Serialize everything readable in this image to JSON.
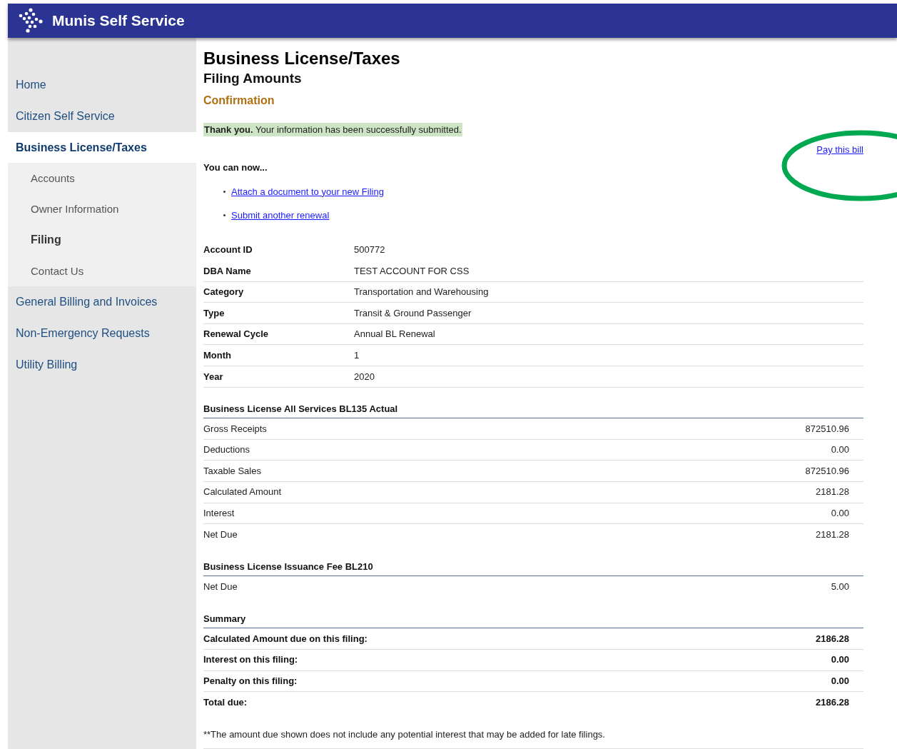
{
  "header": {
    "title": "Munis Self Service"
  },
  "nav": [
    {
      "label": "Home",
      "selected": false
    },
    {
      "label": "Citizen Self Service",
      "selected": false
    },
    {
      "label": "Business License/Taxes",
      "selected": true,
      "children": [
        {
          "label": "Accounts",
          "selected": false
        },
        {
          "label": "Owner Information",
          "selected": false
        },
        {
          "label": "Filing",
          "selected": true
        },
        {
          "label": "Contact Us",
          "selected": false
        }
      ]
    },
    {
      "label": "General Billing and Invoices",
      "selected": false
    },
    {
      "label": "Non-Emergency Requests",
      "selected": false
    },
    {
      "label": "Utility Billing",
      "selected": false
    }
  ],
  "page": {
    "title": "Business License/Taxes",
    "subtitle": "Filing Amounts",
    "step": "Confirmation"
  },
  "notice": "**Thank you.** Your information has been successfully submitted.",
  "pay_link": "Pay this bill",
  "next_steps": {
    "heading": "You can now...",
    "links": [
      "Attach a document to your new Filing",
      "Submit another renewal"
    ]
  },
  "details": [
    {
      "label": "Account ID",
      "value": "500772"
    },
    {
      "label": "DBA Name",
      "value": "TEST ACCOUNT FOR CSS"
    },
    {
      "label": "Category",
      "value": "Transportation and Warehousing"
    },
    {
      "label": "Type",
      "value": "Transit & Ground Passenger"
    },
    {
      "label": "Renewal Cycle",
      "value": "Annual BL Renewal"
    },
    {
      "label": "Month",
      "value": "1"
    },
    {
      "label": "Year",
      "value": "2020"
    }
  ],
  "sections": [
    {
      "title": "Business License All Services  BL135 Actual",
      "kind": "normal",
      "rows": [
        {
          "label": "Gross Receipts",
          "value": "872510.96"
        },
        {
          "label": "Deductions",
          "value": "0.00"
        },
        {
          "label": "Taxable Sales",
          "value": "872510.96"
        },
        {
          "label": "Calculated Amount",
          "value": "2181.28"
        },
        {
          "label": "Interest",
          "value": "0.00"
        },
        {
          "label": "Net Due",
          "value": "2181.28"
        }
      ]
    },
    {
      "title": "Business License Issuance Fee  BL210",
      "kind": "normal",
      "rows": [
        {
          "label": "Net Due",
          "value": "5.00"
        }
      ]
    },
    {
      "title": "Summary",
      "kind": "summary",
      "rows": [
        {
          "label": "Calculated Amount due on this filing:",
          "value": "2186.28"
        },
        {
          "label": "Interest on this filing:",
          "value": "0.00"
        },
        {
          "label": "Penalty on this filing:",
          "value": "0.00"
        },
        {
          "label": "Total due:",
          "value": "2186.28"
        }
      ]
    }
  ],
  "footnote": "**The amount due shown does not include any potential interest that may be added for late filings."
}
